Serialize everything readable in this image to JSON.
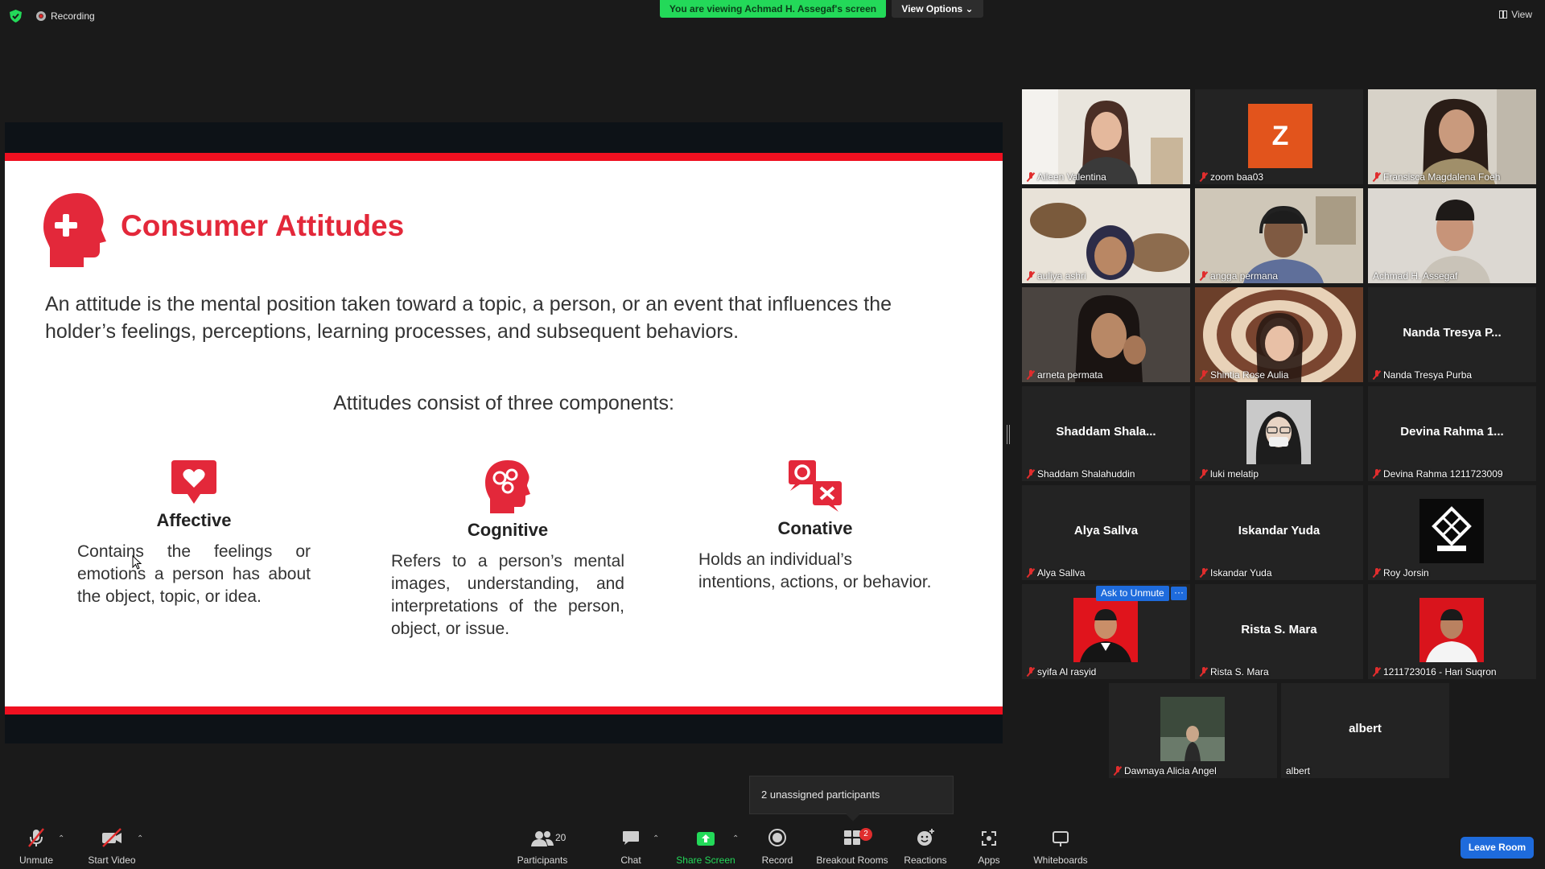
{
  "topbar": {
    "recording_label": "Recording",
    "viewing_banner": "You are viewing Achmad H. Assegaf's screen",
    "view_options": "View Options ⌄",
    "view_label": "View"
  },
  "slide": {
    "title": "Consumer Attitudes",
    "intro": "An attitude is the mental position taken toward a topic, a person, or an event that influences the holder’s feelings, perceptions, learning processes, and subsequent behaviors.",
    "subtitle": "Attitudes consist of three components:",
    "components": [
      {
        "title": "Affective",
        "desc": "Contains the feelings or emotions a person has about the object, topic, or idea."
      },
      {
        "title": "Cognitive",
        "desc": "Refers to a person’s mental images, understanding, and interpretations of the person, object, or issue."
      },
      {
        "title": "Conative",
        "desc": "Holds an individual’s intentions, actions, or behavior."
      }
    ],
    "accent_color": "#e3283a",
    "bar_color": "#ef1020"
  },
  "gallery": {
    "participants": [
      {
        "name": "Aileen Valentina",
        "type": "video"
      },
      {
        "name": "zoom baa03",
        "type": "letter",
        "letter": "Z"
      },
      {
        "name": "Fransisca Magdalena Foeh",
        "type": "video"
      },
      {
        "name": "auliya ashri",
        "type": "video"
      },
      {
        "name": "angga permana",
        "type": "video"
      },
      {
        "name": "Achmad H. Assegaf",
        "type": "video",
        "active_speaker": true
      },
      {
        "name": "arneta permata",
        "type": "video"
      },
      {
        "name": "Shintia Rose Aulia",
        "type": "video"
      },
      {
        "name": "Nanda Tresya Purba",
        "type": "name",
        "display": "Nanda Tresya P..."
      },
      {
        "name": "Shaddam Shalahuddin",
        "type": "name",
        "display": "Shaddam  Shala..."
      },
      {
        "name": "luki melatip",
        "type": "avatar"
      },
      {
        "name": "Devina Rahma 1211723009",
        "type": "name",
        "display": "Devina Rahma 1..."
      },
      {
        "name": "Alya Sallva",
        "type": "name",
        "display": "Alya Sallva"
      },
      {
        "name": "Iskandar Yuda",
        "type": "name",
        "display": "Iskandar Yuda"
      },
      {
        "name": "Roy Jorsin",
        "type": "avatar"
      },
      {
        "name": "syifa Al rasyid",
        "type": "avatar"
      },
      {
        "name": "Rista S. Mara",
        "type": "name",
        "display": "Rista S. Mara"
      },
      {
        "name": "1211723016 - Hari Suqron",
        "type": "avatar"
      },
      {
        "name": "Dawnaya Alicia Angel",
        "type": "avatar"
      },
      {
        "name": "albert",
        "type": "name",
        "display": "albert",
        "muted": false
      }
    ],
    "ask_to_unmute": "Ask to Unmute",
    "more_label": "···",
    "active_speaker_color": "#c6e63a"
  },
  "popup": {
    "unassigned": "2 unassigned participants"
  },
  "toolbar": {
    "unmute": "Unmute",
    "start_video": "Start Video",
    "participants": "Participants",
    "participants_count": "20",
    "chat": "Chat",
    "share_screen": "Share Screen",
    "record": "Record",
    "breakout_rooms": "Breakout Rooms",
    "breakout_badge": "2",
    "reactions": "Reactions",
    "apps": "Apps",
    "whiteboards": "Whiteboards",
    "leave": "Leave Room"
  }
}
